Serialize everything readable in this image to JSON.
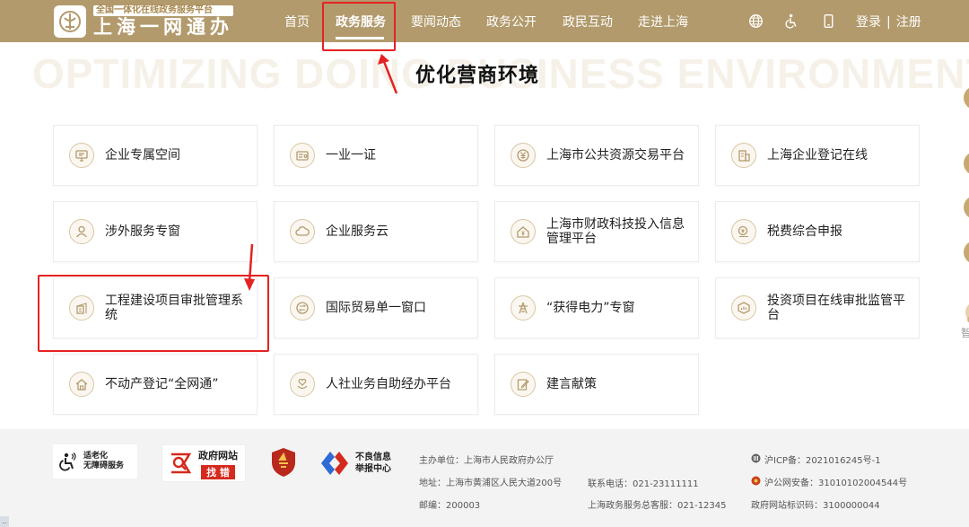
{
  "header": {
    "logo_subtitle": "全国一体化在线政务服务平台",
    "logo_title": "上海一网通办",
    "nav": [
      {
        "label": "首页",
        "active": false
      },
      {
        "label": "政务服务",
        "active": true
      },
      {
        "label": "要闻动态",
        "active": false
      },
      {
        "label": "政务公开",
        "active": false
      },
      {
        "label": "政民互动",
        "active": false
      },
      {
        "label": "走进上海",
        "active": false
      }
    ],
    "tools": [
      "globe-icon",
      "accessibility-icon",
      "mobile-icon"
    ],
    "login_label": "登录",
    "separator": "|",
    "register_label": "注册"
  },
  "section": {
    "background_text": "OPTIMIZING DOING BUSINESS ENVIRONMENT",
    "title": "优化营商环境"
  },
  "services": [
    {
      "label": "企业专属空间",
      "icon": "monitor-icon"
    },
    {
      "label": "一业一证",
      "icon": "certificate-icon"
    },
    {
      "label": "上海市公共资源交易平台",
      "icon": "yuan-coin-icon"
    },
    {
      "label": "上海企业登记在线",
      "icon": "building-icon"
    },
    {
      "label": "涉外服务专窗",
      "icon": "person-icon"
    },
    {
      "label": "企业服务云",
      "icon": "cloud-icon"
    },
    {
      "label": "上海市财政科技投入信息管理平台",
      "icon": "house-yuan-icon"
    },
    {
      "label": "税费综合申报",
      "icon": "tax-icon"
    },
    {
      "label": "工程建设项目审批管理系统",
      "icon": "construction-icon"
    },
    {
      "label": "国际贸易单一窗口",
      "icon": "trade-icon"
    },
    {
      "label": "“获得电力”专窗",
      "icon": "power-tower-icon"
    },
    {
      "label": "投资项目在线审批监管平台",
      "icon": "investment-icon"
    },
    {
      "label": "不动产登记“全网通”",
      "icon": "home-icon"
    },
    {
      "label": "人社业务自助经办平台",
      "icon": "heart-hand-icon"
    },
    {
      "label": "建言献策",
      "icon": "edit-icon"
    }
  ],
  "side": {
    "robot_label": "智"
  },
  "footer": {
    "elder_badge": {
      "line1": "适老化",
      "line2": "无障碍服务"
    },
    "gov_badge": {
      "line1": "政府网站",
      "line2": "找 错"
    },
    "report_badge": {
      "line1": "不良信息",
      "line2": "举报中心"
    },
    "sponsor": "主办单位：上海市人民政府办公厅",
    "address": "地址：上海市黄浦区人民大道200号",
    "postcode": "邮编：200003",
    "phone": "联系电话：021-23111111",
    "hotline": "上海政务服务总客服：021-12345",
    "icp": "沪ICP备：2021016245号-1",
    "police": "沪公网安备：31010102004544号",
    "site_code": "政府网站标识码：3100000044"
  },
  "colors": {
    "header_bg": "#b29a6c",
    "accent_gold": "#c6a971",
    "annotation_red": "#e52222"
  }
}
